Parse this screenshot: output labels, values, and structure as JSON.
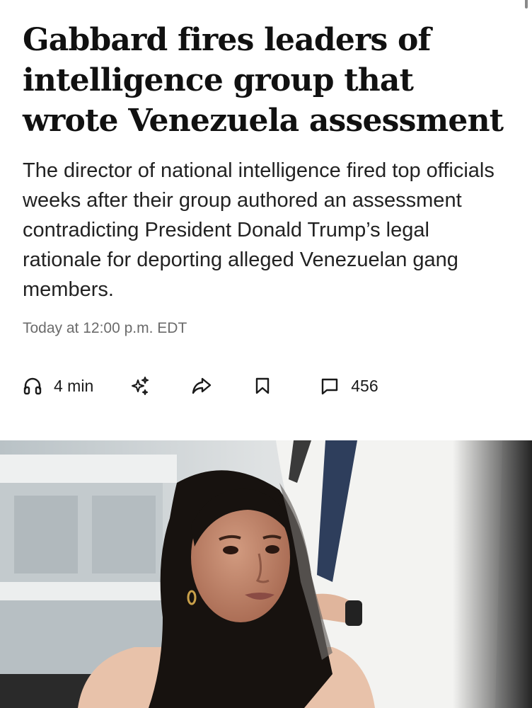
{
  "article": {
    "headline": "Gabbard fires leaders of intelligence group that wrote Venezuela assessment",
    "dek": "The director of national intelligence fired top officials weeks after their group authored an assessment contradicting President Donald Trump’s legal rationale for deporting alleged Venezuelan gang members.",
    "timestamp": "Today at 12:00 p.m. EDT"
  },
  "actions": {
    "listen": {
      "icon": "headphones-icon",
      "label": "4 min"
    },
    "summary": {
      "icon": "sparkle-icon"
    },
    "share": {
      "icon": "share-arrow-icon"
    },
    "save": {
      "icon": "bookmark-icon"
    },
    "comments": {
      "icon": "comment-icon",
      "count": "456"
    }
  },
  "colors": {
    "text": "#111111",
    "meta": "#6b6b6b"
  }
}
